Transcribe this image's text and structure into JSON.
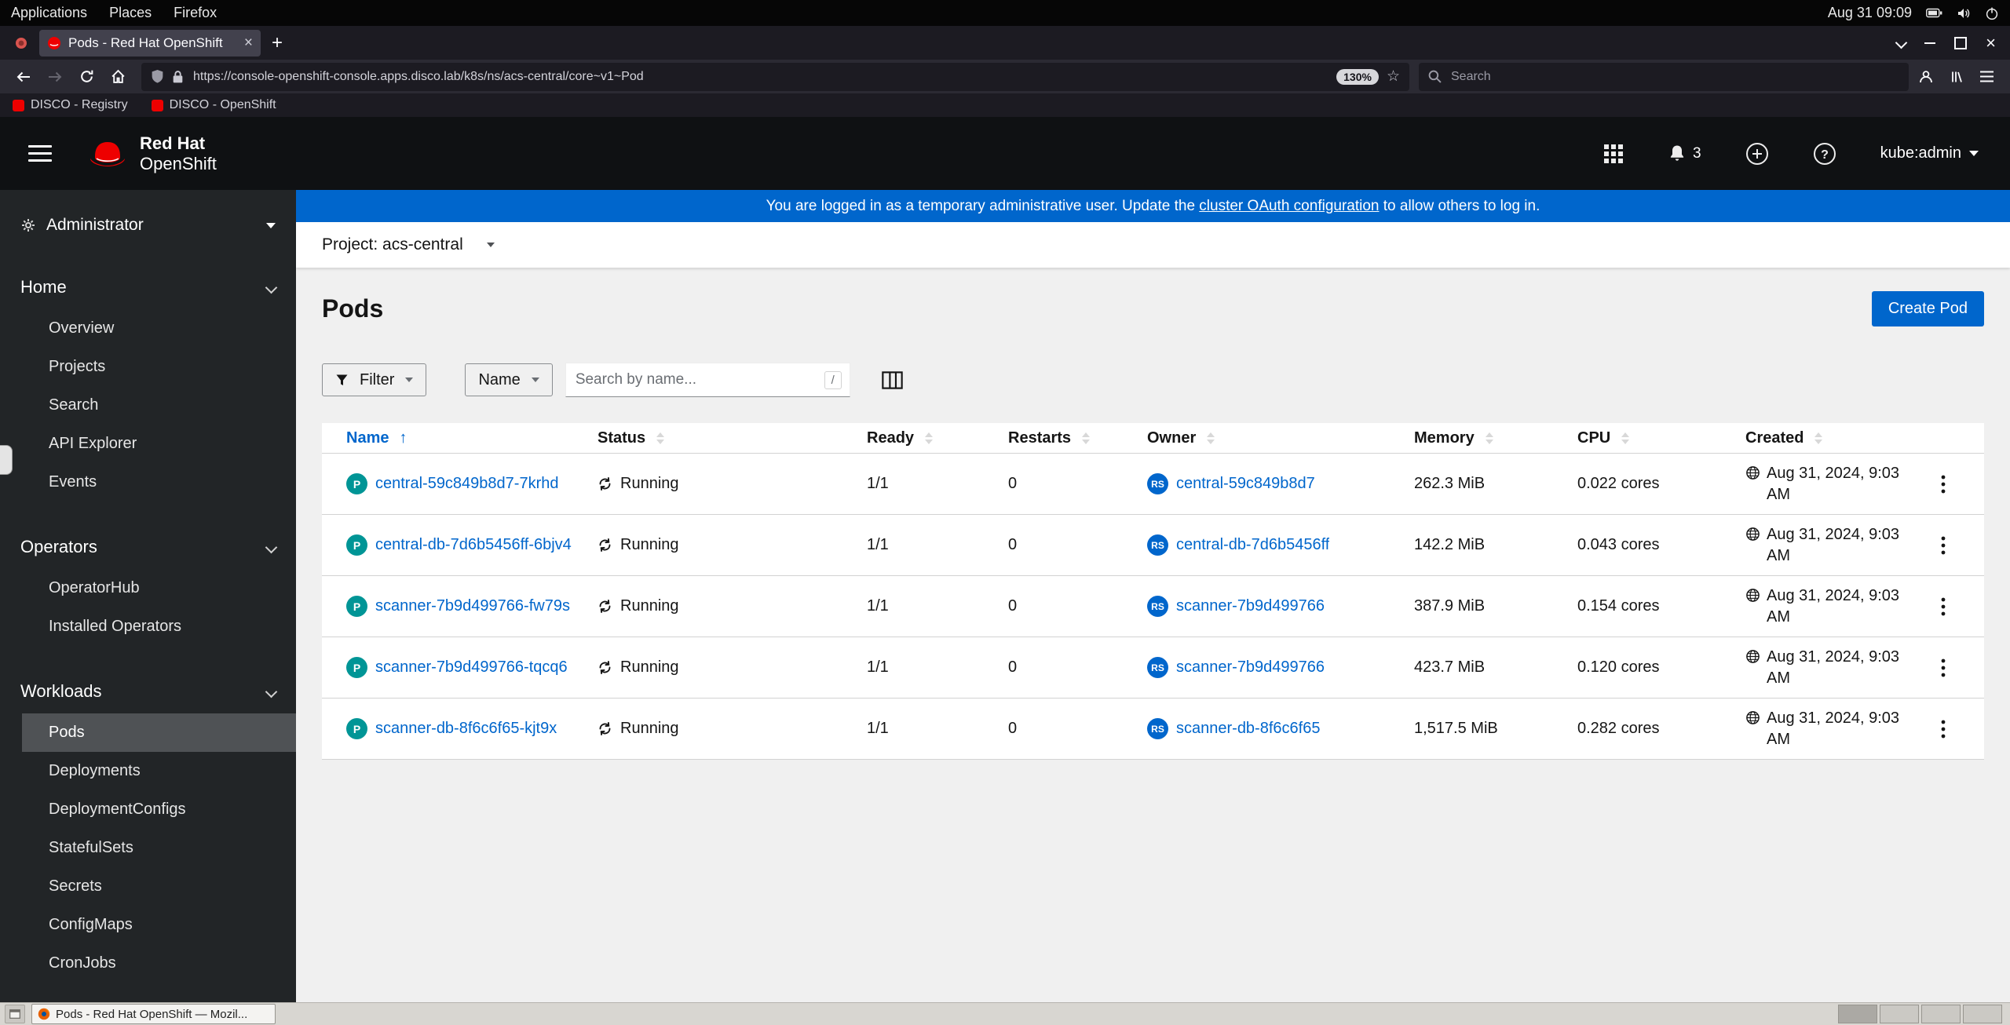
{
  "system_bar": {
    "menu_applications": "Applications",
    "menu_places": "Places",
    "menu_firefox": "Firefox",
    "clock": "Aug 31 09:09"
  },
  "browser": {
    "tab_title": "Pods - Red Hat OpenShift",
    "url": "https://console-openshift-console.apps.disco.lab/k8s/ns/acs-central/core~v1~Pod",
    "zoom_level": "130%",
    "search_placeholder": "Search",
    "bookmarks": [
      "DISCO - Registry",
      "DISCO - OpenShift"
    ]
  },
  "masthead": {
    "brand_top": "Red Hat",
    "brand_bottom": "OpenShift",
    "notification_count": "3",
    "username": "kube:admin"
  },
  "banner": {
    "prefix": "You are logged in as a temporary administrative user. Update the ",
    "link_text": "cluster OAuth configuration",
    "suffix": " to allow others to log in."
  },
  "sidebar": {
    "perspective": "Administrator",
    "sections": [
      {
        "label": "Home",
        "items": [
          {
            "label": "Overview"
          },
          {
            "label": "Projects"
          },
          {
            "label": "Search"
          },
          {
            "label": "API Explorer"
          },
          {
            "label": "Events"
          }
        ]
      },
      {
        "label": "Operators",
        "items": [
          {
            "label": "OperatorHub"
          },
          {
            "label": "Installed Operators"
          }
        ]
      },
      {
        "label": "Workloads",
        "items": [
          {
            "label": "Pods",
            "active": true
          },
          {
            "label": "Deployments"
          },
          {
            "label": "DeploymentConfigs"
          },
          {
            "label": "StatefulSets"
          },
          {
            "label": "Secrets"
          },
          {
            "label": "ConfigMaps"
          },
          {
            "label": "CronJobs"
          }
        ]
      }
    ]
  },
  "project_bar": {
    "label": "Project: acs-central"
  },
  "page_header": {
    "title": "Pods",
    "create_button": "Create Pod"
  },
  "toolbar": {
    "filter": "Filter",
    "attribute": "Name",
    "search_placeholder": "Search by name...",
    "shortcut": "/"
  },
  "table": {
    "headers": {
      "name": "Name",
      "status": "Status",
      "ready": "Ready",
      "restarts": "Restarts",
      "owner": "Owner",
      "memory": "Memory",
      "cpu": "CPU",
      "created": "Created"
    },
    "pod_badge": "P",
    "owner_badge": "RS",
    "rows": [
      {
        "name": "central-59c849b8d7-7krhd",
        "status": "Running",
        "ready": "1/1",
        "restarts": "0",
        "owner": "central-59c849b8d7",
        "memory": "262.3 MiB",
        "cpu": "0.022 cores",
        "created": "Aug 31, 2024, 9:03 AM"
      },
      {
        "name": "central-db-7d6b5456ff-6bjv4",
        "status": "Running",
        "ready": "1/1",
        "restarts": "0",
        "owner": "central-db-7d6b5456ff",
        "memory": "142.2 MiB",
        "cpu": "0.043 cores",
        "created": "Aug 31, 2024, 9:03 AM"
      },
      {
        "name": "scanner-7b9d499766-fw79s",
        "status": "Running",
        "ready": "1/1",
        "restarts": "0",
        "owner": "scanner-7b9d499766",
        "memory": "387.9 MiB",
        "cpu": "0.154 cores",
        "created": "Aug 31, 2024, 9:03 AM"
      },
      {
        "name": "scanner-7b9d499766-tqcq6",
        "status": "Running",
        "ready": "1/1",
        "restarts": "0",
        "owner": "scanner-7b9d499766",
        "memory": "423.7 MiB",
        "cpu": "0.120 cores",
        "created": "Aug 31, 2024, 9:03 AM"
      },
      {
        "name": "scanner-db-8f6c6f65-kjt9x",
        "status": "Running",
        "ready": "1/1",
        "restarts": "0",
        "owner": "scanner-db-8f6c6f65",
        "memory": "1,517.5 MiB",
        "cpu": "0.282 cores",
        "created": "Aug 31, 2024, 9:03 AM"
      }
    ]
  },
  "taskbar": {
    "task_label": "Pods - Red Hat OpenShift — Mozil...",
    "workspace_count": 4
  },
  "colors": {
    "accent_blue": "#0066cc",
    "pod_badge_teal": "#009596",
    "replicaset_badge_blue": "#0066cc",
    "banner_blue": "#0066cc",
    "sidebar_dark": "#222527",
    "masthead_dark": "#0f1113"
  }
}
